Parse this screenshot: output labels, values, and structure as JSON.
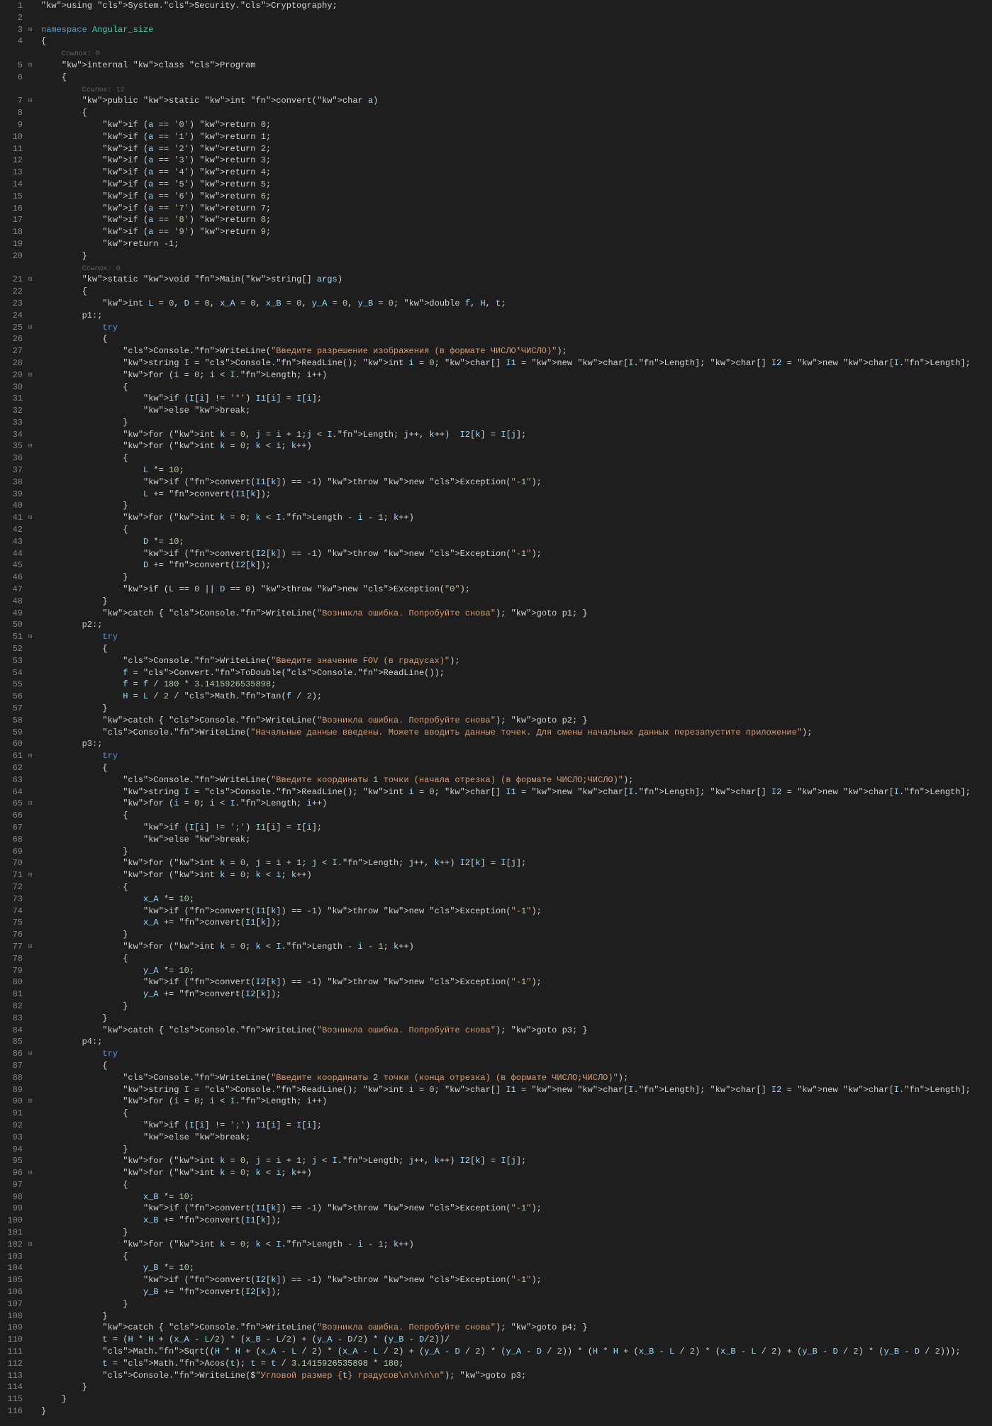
{
  "filename": "Program.cs",
  "language": "csharp",
  "theme": "dark",
  "colors": {
    "background": "#1e1e1e",
    "keyword": "#569cd6",
    "class": "#4ec9b0",
    "string": "#d69d73",
    "number": "#b5cea8",
    "function": "#dcdcaa",
    "variable": "#9cdcfe",
    "reference": "#606060"
  },
  "line_count": 116,
  "references": {
    "program_class": "Ссылок: 0",
    "convert_method": "Ссылок: 12",
    "main_method": "Ссылок: 0"
  },
  "code": {
    "using_stmt": "using System.Security.Cryptography;",
    "namespace": "namespace Angular_size",
    "class_decl": "internal class Program",
    "convert_sig": "public static int convert(char a)",
    "convert_body": [
      "if (a == '0') return 0;",
      "if (a == '1') return 1;",
      "if (a == '2') return 2;",
      "if (a == '3') return 3;",
      "if (a == '4') return 4;",
      "if (a == '5') return 5;",
      "if (a == '6') return 6;",
      "if (a == '7') return 7;",
      "if (a == '8') return 8;",
      "if (a == '9') return 9;",
      "return -1;"
    ],
    "main_sig": "static void Main(string[] args)",
    "main_vars": "int L = 0, D = 0, x_A = 0, x_B = 0, y_A = 0, y_B = 0; double f, H, t;",
    "labels": [
      "p1:;",
      "p2:;",
      "p3:;",
      "p4:;"
    ],
    "try1_writeline": "Console.WriteLine(\"Введите разрешение изображения (в формате ЧИСЛО*ЧИСЛО)\");",
    "readline_decl": "string I = Console.ReadLine(); int i = 0; char[] I1 = new char[I.Length]; char[] I2 = new char[I.Length];",
    "for_loop1": "for (i = 0; i < I.Length; i++)",
    "if_star": "if (I[i] != '*') I1[i] = I[i];",
    "else_break": "else break;",
    "for_loop2": "for (int k = 0, j = i + 1;j < I.Length; j++, k++)  I2[k] = I[j];",
    "for_loop3": "for (int k = 0; k < i; k++)",
    "L_mult": "L *= 10;",
    "L_throw": "if (convert(I1[k]) == -1) throw new Exception(\"-1\");",
    "L_add": "L += convert(I1[k]);",
    "for_loop4": "for (int k = 0; k < I.Length - i - 1; k++)",
    "D_mult": "D *= 10;",
    "D_throw": "if (convert(I2[k]) == -1) throw new Exception(\"-1\");",
    "D_add": "D += convert(I2[k]);",
    "LD_check": "if (L == 0 || D == 0) throw new Exception(\"0\");",
    "catch1": "catch { Console.WriteLine(\"Возникла ошибка. Попробуйте снова\"); goto p1; }",
    "try2_writeline": "Console.WriteLine(\"Введите значение FOV (в градусах)\");",
    "f_assign": "f = Convert.ToDouble(Console.ReadLine());",
    "f_calc": "f = f / 180 * 3.1415926535898;",
    "H_calc": "H = L / 2 / Math.Tan(f / 2);",
    "catch2": "catch { Console.WriteLine(\"Возникла ошибка. Попробуйте снова\"); goto p2; }",
    "info_line": "Console.WriteLine(\"Начальные данные введены. Можете вводить данные точек. Для смены начальных данных перезапустите приложение\");",
    "try3_writeline": "Console.WriteLine(\"Введите координаты 1 точки (начала отрезка) (в формате ЧИСЛО;ЧИСЛО)\");",
    "if_semicolon": "if (I[i] != ';') I1[i] = I[i];",
    "for_loop_j": "for (int k = 0, j = i + 1; j < I.Length; j++, k++) I2[k] = I[j];",
    "xA_mult": "x_A *= 10;",
    "xA_throw": "if (convert(I1[k]) == -1) throw new Exception(\"-1\");",
    "xA_add": "x_A += convert(I1[k]);",
    "yA_mult": "y_A *= 10;",
    "yA_throw": "if (convert(I2[k]) == -1) throw new Exception(\"-1\");",
    "yA_add": "y_A += convert(I2[k]);",
    "catch3": "catch { Console.WriteLine(\"Возникла ошибка. Попробуйте снова\"); goto p3; }",
    "try4_writeline": "Console.WriteLine(\"Введите координаты 2 точки (конца отрезка) (в формате ЧИСЛО;ЧИСЛО)\");",
    "xB_mult": "x_B *= 10;",
    "xB_throw": "if (convert(I1[k]) == -1) throw new Exception(\"-1\");",
    "xB_add": "x_B += convert(I1[k]);",
    "yB_mult": "y_B *= 10;",
    "yB_throw": "if (convert(I2[k]) == -1) throw new Exception(\"-1\");",
    "yB_add": "y_B += convert(I2[k]);",
    "catch4": "catch { Console.WriteLine(\"Возникла ошибка. Попробуйте снова\"); goto p4; }",
    "t_calc1": "t = (H * H + (x_A - L/2) * (x_B - L/2) + (y_A - D/2) * (y_B - D/2))/",
    "t_calc2": "Math.Sqrt((H * H + (x_A - L / 2) * (x_A - L / 2) + (y_A - D / 2) * (y_A - D / 2)) * (H * H + (x_B - L / 2) * (x_B - L / 2) + (y_B - D / 2) * (y_B - D / 2)));",
    "t_acos": "t = Math.Acos(t); t = t / 3.1415926535898 * 180;",
    "final_write": "Console.WriteLine($\"Угловой размер {t} градусов\\n\\n\\n\\n\"); goto p3;"
  }
}
